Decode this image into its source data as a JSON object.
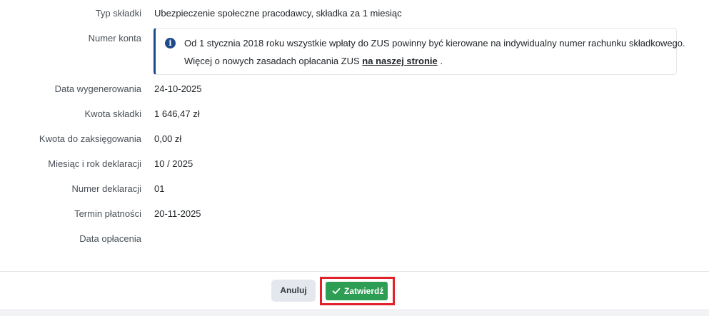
{
  "fields": [
    {
      "label": "Typ składki",
      "value": "Ubezpieczenie społeczne pracodawcy, składka za 1 miesiąc"
    },
    {
      "label": "Numer konta",
      "value": ""
    },
    {
      "label": "Data wygenerowania",
      "value": "24-10-2025"
    },
    {
      "label": "Kwota składki",
      "value": "1 646,47 zł"
    },
    {
      "label": "Kwota do zaksięgowania",
      "value": "0,00 zł"
    },
    {
      "label": "Miesiąc i rok deklaracji",
      "value": "10 / 2025"
    },
    {
      "label": "Numer deklaracji",
      "value": "01"
    },
    {
      "label": "Termin płatności",
      "value": "20-11-2025"
    },
    {
      "label": "Data opłacenia",
      "value": ""
    }
  ],
  "info_alert": {
    "icon": "info-icon",
    "line1": "Od 1 stycznia 2018 roku wszystkie wpłaty do ZUS powinny być kierowane na indywidualny numer rachunku składkowego.",
    "line2_prefix": "Więcej o nowych zasadach opłacania ZUS ",
    "link_text": "na naszej stronie",
    "line2_suffix": " ."
  },
  "footer": {
    "cancel_label": "Anuluj",
    "confirm_label": "Zatwierdź",
    "confirm_icon": "check-icon"
  },
  "colors": {
    "confirm_button": "#2f9e55",
    "highlight_border": "#e2202a",
    "info_accent": "#1f4a8a"
  }
}
